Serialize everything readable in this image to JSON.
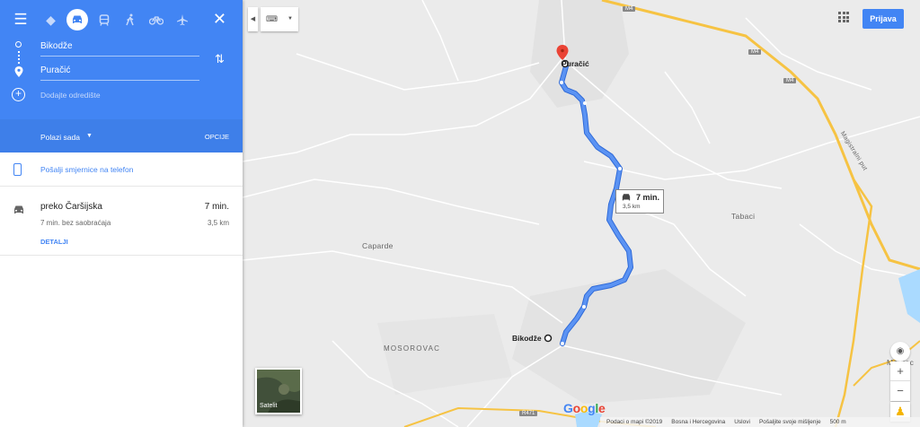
{
  "panel": {
    "modes": [
      "menu-icon",
      "best-travel-icon",
      "car-icon",
      "transit-icon",
      "walk-icon",
      "bicycle-icon",
      "flight-icon"
    ],
    "close_label": "✕",
    "origin": "Bikodže",
    "destination": "Puračić",
    "add_destination_placeholder": "Dodajte odredište",
    "depart_label": "Polazi sada",
    "options_label": "OPCIJE",
    "send_to_phone": "Pošalji smjernice na telefon",
    "trip": {
      "via": "preko Čaršijska",
      "time": "7 min.",
      "note": "7 min. bez saobraćaja",
      "distance": "3,5 km",
      "details": "DETALJI"
    }
  },
  "map": {
    "signin_label": "Prijava",
    "places": {
      "puracic": "Puračić",
      "bikodze": "Bikodže",
      "caparde": "Caparde",
      "tabaci": "Tabaci",
      "mosorovac": "MOSOROVAC",
      "modrac": "Modrac",
      "magistral": "Magistralni put"
    },
    "road_shields": {
      "m4_top": "M4",
      "m4_mid": "M4",
      "m4_right": "M4",
      "r471": "R471"
    },
    "route_info": {
      "time": "7 min.",
      "distance": "3,5 km"
    },
    "satellite_label": "Satelit",
    "zoom_in": "+",
    "zoom_out": "−",
    "google_logo": "Google",
    "footer": {
      "data": "Podaci o mapi ©2019",
      "country": "Bosna i Hercegovina",
      "terms": "Uslovi",
      "feedback": "Pošaljite svoje mišljenje",
      "scale": "500 m"
    },
    "colors": {
      "route": "#4a85ef",
      "highway": "#f6c343",
      "brand": "#4285f4"
    }
  }
}
